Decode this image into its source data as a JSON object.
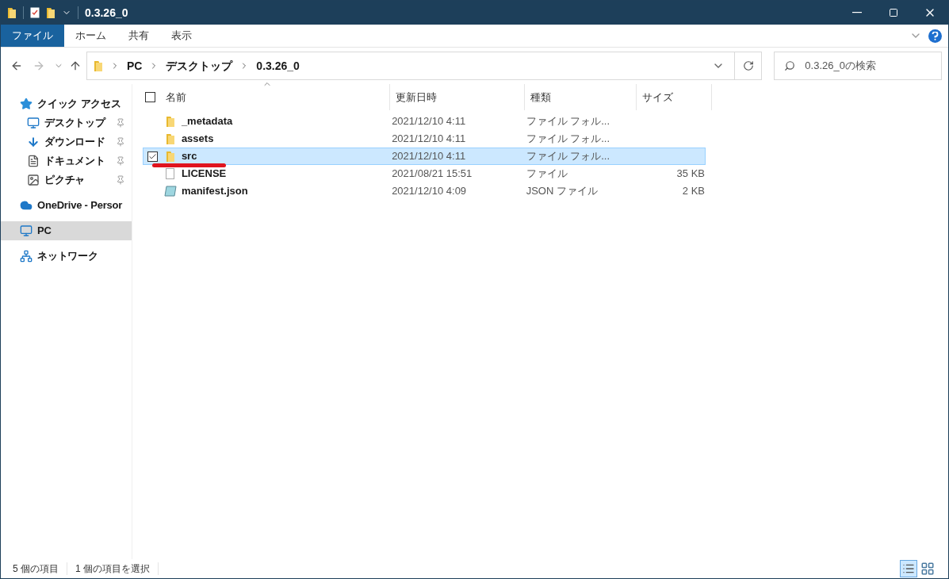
{
  "window": {
    "title": "0.3.26_0"
  },
  "ribbon_tabs": [
    {
      "label": "ファイル",
      "selected": true
    },
    {
      "label": "ホーム",
      "selected": false
    },
    {
      "label": "共有",
      "selected": false
    },
    {
      "label": "表示",
      "selected": false
    }
  ],
  "breadcrumb": [
    "PC",
    "デスクトップ",
    "0.3.26_0"
  ],
  "search": {
    "placeholder": "0.3.26_0の検索"
  },
  "sidebar": {
    "items": [
      {
        "label": "クイック アクセス",
        "kind": "quick",
        "selected": false,
        "children": [
          {
            "label": "デスクトップ",
            "kind": "desktop",
            "pinned": true,
            "selected": false
          },
          {
            "label": "ダウンロード",
            "kind": "download",
            "pinned": true,
            "selected": false
          },
          {
            "label": "ドキュメント",
            "kind": "document",
            "pinned": true,
            "selected": false
          },
          {
            "label": "ピクチャ",
            "kind": "picture",
            "pinned": true,
            "selected": false
          }
        ]
      },
      {
        "label": "OneDrive - Persor",
        "kind": "cloud",
        "selected": false
      },
      {
        "label": "PC",
        "kind": "pc",
        "selected": true
      },
      {
        "label": "ネットワーク",
        "kind": "network",
        "selected": false
      }
    ]
  },
  "table": {
    "select_all_checked": false,
    "columns": [
      "名前",
      "更新日時",
      "種類",
      "サイズ"
    ],
    "rows": [
      {
        "name": "_metadata",
        "kind": "folder",
        "modified": "2021/12/10 4:11",
        "type": "ファイル フォル...",
        "selected": false
      },
      {
        "name": "assets",
        "kind": "folder",
        "modified": "2021/12/10 4:11",
        "type": "ファイル フォル...",
        "selected": false
      },
      {
        "name": "src",
        "kind": "folder",
        "modified": "2021/12/10 4:11",
        "type": "ファイル フォル...",
        "selected": true
      },
      {
        "name": "LICENSE",
        "kind": "file",
        "modified": "2021/08/21 15:51",
        "type": "ファイル",
        "size": "35 KB",
        "selected": false
      },
      {
        "name": "manifest.json",
        "kind": "json",
        "modified": "2021/12/10 4:09",
        "type": "JSON ファイル",
        "size": "2 KB",
        "selected": false
      }
    ]
  },
  "status_bar": {
    "item_count": "5 個の項目",
    "selection": "1 個の項目を選択"
  }
}
